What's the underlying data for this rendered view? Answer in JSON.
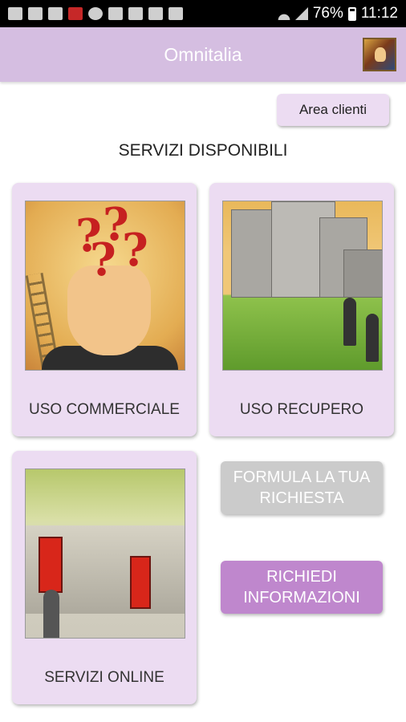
{
  "status_bar": {
    "battery": "76%",
    "time": "11:12"
  },
  "app_bar": {
    "title": "Omnitalia"
  },
  "area_button": "Area clienti",
  "section_title": "SERVIZI DISPONIBILI",
  "cards": [
    {
      "label": "USO COMMERCIALE"
    },
    {
      "label": "USO RECUPERO"
    },
    {
      "label": "SERVIZI ONLINE"
    }
  ],
  "buttons": {
    "formula": "FORMULA LA TUA RICHIESTA",
    "richiedi": "RICHIEDI INFORMAZIONI"
  },
  "colors": {
    "app_bar": "#d5bee1",
    "card_bg": "#ecdcf2",
    "button_primary": "#bf87cd",
    "button_disabled": "#cbcbcb"
  }
}
